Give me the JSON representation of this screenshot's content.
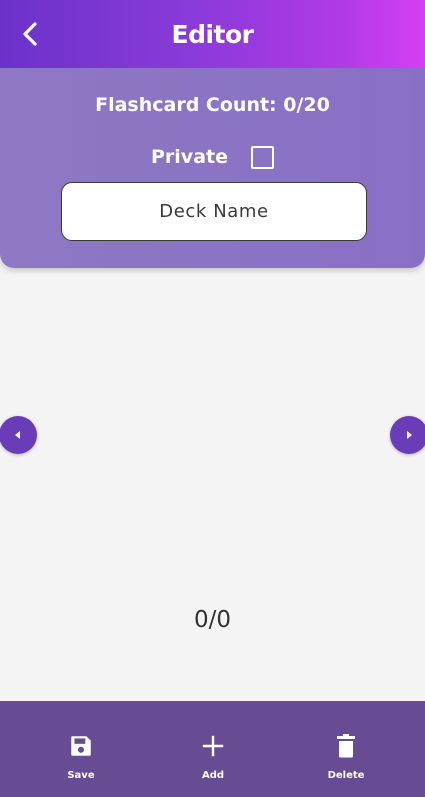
{
  "topbar": {
    "title": "Editor",
    "back_icon": "chevron-left-icon"
  },
  "panel": {
    "flashcard_count_label": "Flashcard Count: 0/20",
    "private_label": "Private",
    "private_checked": false,
    "deck_name": {
      "value": "",
      "placeholder": "Deck Name"
    }
  },
  "card_nav": {
    "prev_icon": "caret-left-icon",
    "next_icon": "caret-right-icon",
    "counter": "0/0"
  },
  "bottombar": {
    "items": [
      {
        "label": "Save",
        "icon": "floppy-disk-icon"
      },
      {
        "label": "Add",
        "icon": "plus-icon"
      },
      {
        "label": "Delete",
        "icon": "trash-icon"
      }
    ]
  },
  "colors": {
    "topbar_gradient_start": "#6b32c9",
    "topbar_gradient_end": "#d63ff4",
    "panel": "#8a74c3",
    "nav_button": "#6a3cb8",
    "bottombar": "#684c93",
    "background": "#f4f4f4"
  }
}
